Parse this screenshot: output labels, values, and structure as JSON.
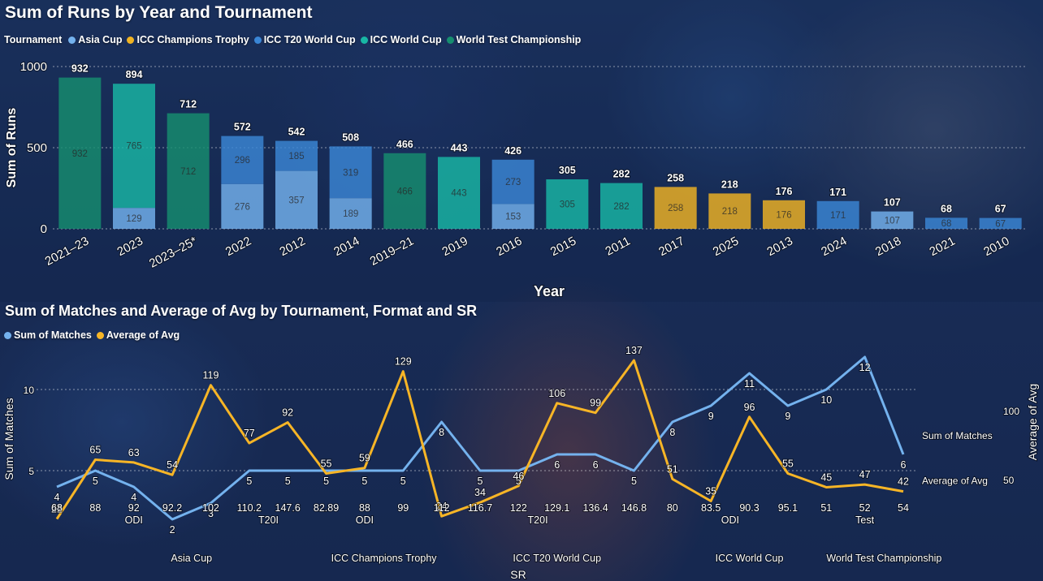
{
  "colors": {
    "asia_cup": "#74b2ee",
    "champions_trophy": "#f0b323",
    "t20_world_cup": "#3a86d6",
    "world_cup": "#18b7a5",
    "wtc": "#168e6f",
    "matches_line": "#74b2ee",
    "avg_line": "#f7b526"
  },
  "top": {
    "title": "Sum of Runs by Year and Tournament",
    "legend_title": "Tournament",
    "legend": [
      {
        "label": "Asia Cup",
        "color_key": "asia_cup"
      },
      {
        "label": "ICC Champions Trophy",
        "color_key": "champions_trophy"
      },
      {
        "label": "ICC T20 World Cup",
        "color_key": "t20_world_cup"
      },
      {
        "label": "ICC World Cup",
        "color_key": "world_cup"
      },
      {
        "label": "World Test Championship",
        "color_key": "wtc"
      }
    ]
  },
  "bottom": {
    "title": "Sum of Matches and Average of Avg by Tournament, Format and SR",
    "legend": [
      {
        "label": "Sum of Matches",
        "color_key": "matches_line"
      },
      {
        "label": "Average of Avg",
        "color_key": "avg_line"
      }
    ]
  },
  "chart_data": [
    {
      "type": "bar",
      "stacked": true,
      "title": "Sum of Runs by Year and Tournament",
      "xlabel": "Year",
      "ylabel": "Sum of Runs",
      "ylim": [
        0,
        1050
      ],
      "y_ticks": [
        0,
        500,
        1000
      ],
      "grid": true,
      "legend_position": "top-left",
      "categories": [
        "2021–23",
        "2023",
        "2023–25*",
        "2022",
        "2012",
        "2014",
        "2019–21",
        "2019",
        "2016",
        "2015",
        "2011",
        "2017",
        "2025",
        "2013",
        "2024",
        "2018",
        "2021",
        "2010"
      ],
      "totals": [
        932,
        894,
        712,
        572,
        542,
        508,
        466,
        443,
        426,
        305,
        282,
        258,
        218,
        176,
        171,
        107,
        68,
        67
      ],
      "series": [
        {
          "name": "Asia Cup",
          "color_key": "asia_cup",
          "values": [
            0,
            129,
            0,
            276,
            357,
            189,
            0,
            0,
            153,
            0,
            0,
            0,
            0,
            0,
            0,
            107,
            0,
            0
          ]
        },
        {
          "name": "ICC Champions Trophy",
          "color_key": "champions_trophy",
          "values": [
            0,
            0,
            0,
            0,
            0,
            0,
            0,
            0,
            0,
            0,
            0,
            258,
            218,
            176,
            0,
            0,
            0,
            0
          ]
        },
        {
          "name": "ICC T20 World Cup",
          "color_key": "t20_world_cup",
          "values": [
            0,
            0,
            0,
            296,
            185,
            319,
            0,
            0,
            273,
            0,
            0,
            0,
            0,
            0,
            171,
            0,
            68,
            67
          ]
        },
        {
          "name": "ICC World Cup",
          "color_key": "world_cup",
          "values": [
            0,
            765,
            0,
            0,
            0,
            0,
            0,
            443,
            0,
            305,
            282,
            0,
            0,
            0,
            0,
            0,
            0,
            0
          ]
        },
        {
          "name": "World Test Championship",
          "color_key": "wtc",
          "values": [
            932,
            0,
            712,
            0,
            0,
            0,
            466,
            0,
            0,
            0,
            0,
            0,
            0,
            0,
            0,
            0,
            0,
            0
          ]
        }
      ]
    },
    {
      "type": "line",
      "title": "Sum of Matches and Average of Avg by Tournament, Format and SR",
      "xlabel": "SR",
      "ylabel": "Sum of Matches",
      "y2label": "Average of Avg",
      "ylim": [
        0,
        13.5
      ],
      "y_ticks": [
        5,
        10
      ],
      "y2lim": [
        15,
        146
      ],
      "y2_ticks": [
        50,
        100
      ],
      "grid": true,
      "legend_position": "top-left",
      "x": [
        "68",
        "88",
        "92",
        "92.2",
        "102",
        "110.2",
        "147.6",
        "82.89",
        "88",
        "99",
        "112",
        "116.7",
        "122",
        "129.1",
        "136.4",
        "146.8",
        "80",
        "83.5",
        "90.3",
        "95.1",
        "51",
        "52",
        "54"
      ],
      "format_groups": [
        {
          "label": "ODI",
          "from": 0,
          "to": 4
        },
        {
          "label": "T20I",
          "from": 5,
          "to": 6
        },
        {
          "label": "ODI",
          "from": 7,
          "to": 9
        },
        {
          "label": "T20I",
          "from": 10,
          "to": 15
        },
        {
          "label": "ODI",
          "from": 16,
          "to": 19
        },
        {
          "label": "Test",
          "from": 20,
          "to": 22
        }
      ],
      "tournament_groups": [
        {
          "label": "Asia Cup",
          "from": 0,
          "to": 6
        },
        {
          "label": "ICC Champions Trophy",
          "from": 7,
          "to": 9
        },
        {
          "label": "ICC T20 World Cup",
          "from": 10,
          "to": 15
        },
        {
          "label": "ICC World Cup",
          "from": 16,
          "to": 19
        },
        {
          "label": "World Test Championship",
          "from": 20,
          "to": 22
        }
      ],
      "series": [
        {
          "name": "Sum of Matches",
          "axis": "left",
          "color_key": "matches_line",
          "values": [
            4,
            5,
            4,
            2,
            3,
            5,
            5,
            5,
            5,
            5,
            8,
            5,
            5,
            6,
            6,
            5,
            8,
            9,
            11,
            9,
            10,
            12,
            6
          ]
        },
        {
          "name": "Average of Avg",
          "axis": "right",
          "color_key": "avg_line",
          "values": [
            22,
            65,
            63,
            54,
            119,
            77,
            92,
            55,
            59,
            129,
            24,
            34,
            46,
            106,
            99,
            137,
            51,
            35,
            96,
            55,
            45,
            47,
            42
          ]
        }
      ],
      "end_labels": [
        "Sum of Matches",
        "Average of Avg"
      ]
    }
  ]
}
